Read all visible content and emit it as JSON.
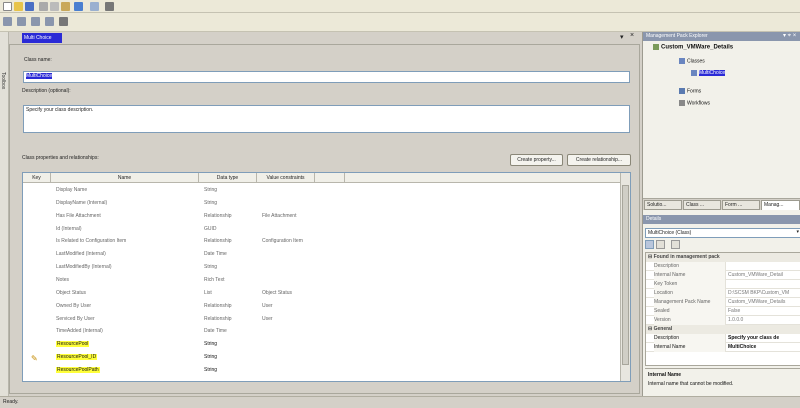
{
  "document_tab": {
    "label": "Multi Choice"
  },
  "toolbox": {
    "label": "Toolbox"
  },
  "form": {
    "class_name_label": "Class name:",
    "class_name_value": "MultiChoice",
    "description_label": "Description (optional):",
    "description_value": "Specify your class description.",
    "props_label": "Class properties and relationships:",
    "create_property_button": "Create property...",
    "create_relationship_button": "Create relationship..."
  },
  "grid": {
    "columns": [
      "Key",
      "Name",
      "Data type",
      "Value constraints"
    ],
    "rows": [
      {
        "key": "",
        "name": "Display Name",
        "type": "String",
        "constraint": ""
      },
      {
        "key": "",
        "name": "DisplayName (Internal)",
        "type": "String",
        "constraint": ""
      },
      {
        "key": "",
        "name": "Has File Attachment",
        "type": "Relationship",
        "constraint": "File Attachment"
      },
      {
        "key": "",
        "name": "Id (Internal)",
        "type": "GUID",
        "constraint": ""
      },
      {
        "key": "",
        "name": "Is Related to Configuration Item",
        "type": "Relationship",
        "constraint": "Configuration Item"
      },
      {
        "key": "",
        "name": "LastModified (Internal)",
        "type": "Date Time",
        "constraint": ""
      },
      {
        "key": "",
        "name": "LastModifiedBy (Internal)",
        "type": "String",
        "constraint": ""
      },
      {
        "key": "",
        "name": "Notes",
        "type": "Rich Text",
        "constraint": ""
      },
      {
        "key": "",
        "name": "Object Status",
        "type": "List",
        "constraint": "Object Status"
      },
      {
        "key": "",
        "name": "Owned By User",
        "type": "Relationship",
        "constraint": "User"
      },
      {
        "key": "",
        "name": "Serviced By User",
        "type": "Relationship",
        "constraint": "User"
      },
      {
        "key": "",
        "name": "TimeAdded (Internal)",
        "type": "Date Time",
        "constraint": ""
      },
      {
        "key": "",
        "name": "ResourcePool",
        "type": "String",
        "constraint": ""
      },
      {
        "key": "",
        "name": "ResourcePool_ID",
        "type": "String",
        "constraint": ""
      },
      {
        "key": "",
        "name": "ResourcePoolPath",
        "type": "String",
        "constraint": ""
      }
    ]
  },
  "explorer": {
    "title": "Management Pack Explorer",
    "root": "Custom_VMWare_Details",
    "classes": "Classes",
    "class_item": "MultiChoice",
    "forms": "Forms",
    "workflows": "Workflows"
  },
  "right_tabs": [
    "Solutio...",
    "Class ...",
    "Form ...",
    "Manag..."
  ],
  "details": {
    "title": "Details",
    "selected": "MultiChoice (Class)",
    "cat1": "Found in management pack",
    "cat1_rows": [
      {
        "k": "Description",
        "v": ""
      },
      {
        "k": "Internal Name",
        "v": "Custom_VMWare_Detail"
      },
      {
        "k": "Key Token",
        "v": ""
      },
      {
        "k": "Location",
        "v": "D:\\SCSM BKP\\Custom_VM"
      },
      {
        "k": "Management Pack Name",
        "v": "Custom_VMWare_Details"
      },
      {
        "k": "Sealed",
        "v": "False"
      },
      {
        "k": "Version",
        "v": "1.0.0.0"
      }
    ],
    "cat2": "General",
    "cat2_rows": [
      {
        "k": "Description",
        "v": "Specify your class de"
      },
      {
        "k": "Internal Name",
        "v": "MultiChoice"
      }
    ],
    "help_title": "Internal Name",
    "help_text": "Internal name that cannot be modified."
  },
  "status": {
    "text": "Ready."
  },
  "colors": {
    "highlight": "#ffff3a",
    "accent": "#2a2ad6"
  }
}
